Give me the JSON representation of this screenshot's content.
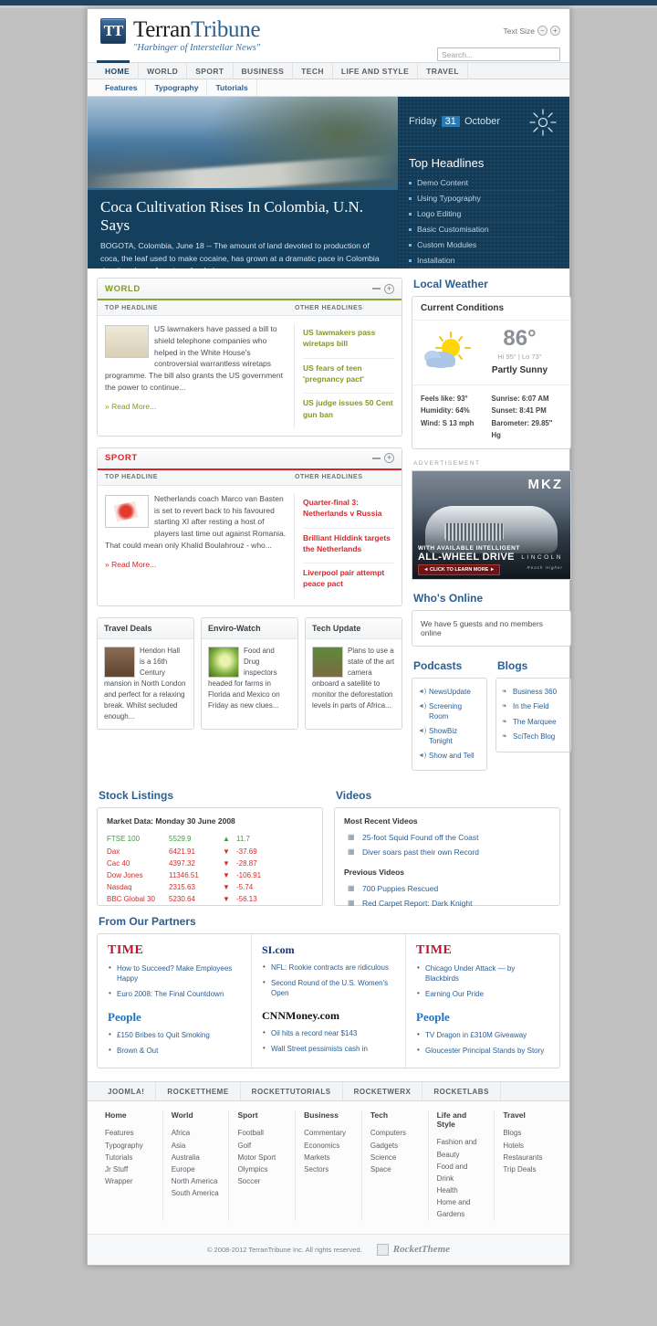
{
  "header": {
    "logo_mark": "TT",
    "title_a": "Terran",
    "title_b": "Tribune",
    "tagline": "\"Harbinger of Interstellar News\"",
    "text_size_label": "Text Size",
    "text_size_decrease": "−",
    "text_size_increase": "+",
    "search_placeholder": "Search..."
  },
  "nav": {
    "items": [
      {
        "label": "HOME",
        "active": true
      },
      {
        "label": "WORLD",
        "active": false
      },
      {
        "label": "SPORT",
        "active": false
      },
      {
        "label": "BUSINESS",
        "active": false
      },
      {
        "label": "TECH",
        "active": false
      },
      {
        "label": "LIFE AND STYLE",
        "active": false
      },
      {
        "label": "TRAVEL",
        "active": false
      }
    ],
    "sub_items": [
      {
        "label": "Features"
      },
      {
        "label": "Typography"
      },
      {
        "label": "Tutorials"
      }
    ]
  },
  "hero": {
    "headline": "Coca Cultivation Rises In Colombia, U.N. Says",
    "body": "BOGOTA, Colombia, June 18 -- The amount of land devoted to production of coca, the leaf used to make cocaine, has grown at a dramatic pace in Colombia despite a huge American-funded...",
    "date_day": "Friday",
    "date_num": "31",
    "date_month": "October",
    "headlines_title": "Top Headlines",
    "headlines": [
      {
        "label": "Demo Content"
      },
      {
        "label": "Using Typography"
      },
      {
        "label": "Logo Editing"
      },
      {
        "label": "Basic Customisation"
      },
      {
        "label": "Custom Modules"
      },
      {
        "label": "Installation"
      }
    ]
  },
  "world": {
    "title": "WORLD",
    "accent": "#8aa826",
    "sub_top": "TOP HEADLINE",
    "sub_other": "OTHER HEADLINES",
    "article": "US lawmakers have passed a bill to shield telephone companies who helped in the White House's controversial warrantless wiretaps programme. The bill also grants the US government the power to continue...",
    "read_more": "» Read More...",
    "other": [
      {
        "label": "US lawmakers pass wiretaps bill"
      },
      {
        "label": "US fears of teen 'pregnancy pact'"
      },
      {
        "label": "US judge issues 50 Cent gun ban"
      }
    ]
  },
  "sport": {
    "title": "SPORT",
    "accent": "#d8262b",
    "sub_top": "TOP HEADLINE",
    "sub_other": "OTHER HEADLINES",
    "article": "Netherlands coach Marco van Basten is set to revert back to his favoured starting XI after resting a host of players last time out against Romania. That could mean only Khalid Boulahrouz - who...",
    "read_more": "» Read More...",
    "other": [
      {
        "label": "Quarter-final 3: Netherlands v Russia"
      },
      {
        "label": "Brilliant Hiddink targets the Netherlands"
      },
      {
        "label": "Liverpool pair attempt peace pact"
      }
    ]
  },
  "cards": [
    {
      "title": "Travel Deals",
      "body": "Hendon Hall is a 16th Century mansion in North London and perfect for a relaxing break. Whilst secluded enough..."
    },
    {
      "title": "Enviro-Watch",
      "body": "Food and Drug inspectors headed for farms in Florida and Mexico on Friday as new clues..."
    },
    {
      "title": "Tech Update",
      "body": "Plans to use a state of the art camera onboard a satellite to monitor the deforestation levels in parts of Africa..."
    }
  ],
  "weather": {
    "section_title": "Local Weather",
    "box_title": "Current Conditions",
    "temp": "86°",
    "hilo": "Hi 95° | Lo 73°",
    "condition": "Partly Sunny",
    "feels_like": "Feels like: 93°",
    "humidity": "Humidity: 64%",
    "wind": "Wind: S 13 mph",
    "sunrise": "Sunrise: 6:07 AM",
    "sunset": "Sunset: 8:41 PM",
    "barometer": "Barometer: 29.85\" Hg"
  },
  "ad": {
    "label": "ADVERTISEMENT",
    "model": "MKZ",
    "brand_top": "LINCOLN",
    "line1": "WITH AVAILABLE INTELLIGENT",
    "line2": "ALL-WHEEL DRIVE",
    "cta": "◄ CLICK TO LEARN MORE ►",
    "brand": "LINCOLN",
    "brand_sub": "Reach Higher"
  },
  "whos_online": {
    "title": "Who's Online",
    "text": "We have 5 guests and no members online"
  },
  "podcasts": {
    "title": "Podcasts",
    "items": [
      {
        "label": "NewsUpdate"
      },
      {
        "label": "Screening Room"
      },
      {
        "label": "ShowBiz Tonight"
      },
      {
        "label": "Show and Tell"
      }
    ]
  },
  "blogs": {
    "title": "Blogs",
    "items": [
      {
        "label": "Business 360"
      },
      {
        "label": "In the Field"
      },
      {
        "label": "The Marquee"
      },
      {
        "label": "SciTech Blog"
      }
    ]
  },
  "stocks": {
    "title": "Stock Listings",
    "market_data": "Market Data: Monday 30 June 2008",
    "rows": [
      {
        "name": "FTSE 100",
        "value": "5529.9",
        "dir": "up",
        "change": "11.7"
      },
      {
        "name": "Dax",
        "value": "6421.91",
        "dir": "down",
        "change": "-37.69"
      },
      {
        "name": "Cac 40",
        "value": "4397.32",
        "dir": "down",
        "change": "-28.87"
      },
      {
        "name": "Dow Jones",
        "value": "11346.51",
        "dir": "down",
        "change": "-106.91"
      },
      {
        "name": "Nasdaq",
        "value": "2315.63",
        "dir": "down",
        "change": "-5.74"
      },
      {
        "name": "BBC Global 30",
        "value": "5230.64",
        "dir": "down",
        "change": "-56.13"
      }
    ]
  },
  "videos": {
    "title": "Videos",
    "group1": "Most Recent Videos",
    "group1_items": [
      {
        "label": "25-foot Squid Found off the Coast"
      },
      {
        "label": "Diver soars past their own Record"
      }
    ],
    "group2": "Previous Videos",
    "group2_items": [
      {
        "label": "700 Puppies Rescued"
      },
      {
        "label": "Red Carpet Report: Dark Knight"
      }
    ]
  },
  "partners": {
    "title": "From Our Partners",
    "columns": [
      {
        "blocks": [
          {
            "brand": "TIME",
            "brand_kind": "time",
            "items": [
              {
                "label": "How to Succeed? Make Employees Happy"
              },
              {
                "label": "Euro 2008: The Final Countdown"
              }
            ]
          },
          {
            "brand": "People",
            "brand_kind": "people",
            "items": [
              {
                "label": "£150 Bribes to Quit Smoking"
              },
              {
                "label": "Brown & Out"
              }
            ]
          }
        ]
      },
      {
        "blocks": [
          {
            "brand": "SI.com",
            "brand_kind": "si",
            "items": [
              {
                "label": "NFL: Rookie contracts are ridiculous"
              },
              {
                "label": "Second Round of the U.S. Women's Open"
              }
            ]
          },
          {
            "brand": "CNNMoney.com",
            "brand_kind": "cnn",
            "items": [
              {
                "label": "Oil hits a record near $143"
              },
              {
                "label": "Wall Street pessimists cash in"
              }
            ]
          }
        ]
      },
      {
        "blocks": [
          {
            "brand": "TIME",
            "brand_kind": "time",
            "items": [
              {
                "label": "Chicago Under Attack — by Blackbirds"
              },
              {
                "label": "Earning Our Pride"
              }
            ]
          },
          {
            "brand": "People",
            "brand_kind": "people",
            "items": [
              {
                "label": "TV Dragon in £310M Giveaway"
              },
              {
                "label": "Gloucester Principal Stands by Story"
              }
            ]
          }
        ]
      }
    ]
  },
  "footer": {
    "nav": [
      {
        "label": "JOOMLA!"
      },
      {
        "label": "ROCKETTHEME"
      },
      {
        "label": "ROCKETTUTORIALS"
      },
      {
        "label": "ROCKETWERX"
      },
      {
        "label": "ROCKETLABS"
      }
    ],
    "columns": [
      {
        "title": "Home",
        "links": [
          "Features",
          "Typography",
          "Tutorials",
          "Jr Stuff",
          "Wrapper"
        ]
      },
      {
        "title": "World",
        "links": [
          "Africa",
          "Asia",
          "Australia",
          "Europe",
          "North America",
          "South America"
        ]
      },
      {
        "title": "Sport",
        "links": [
          "Football",
          "Golf",
          "Motor Sport",
          "Olympics",
          "Soccer"
        ]
      },
      {
        "title": "Business",
        "links": [
          "Commentary",
          "Economics",
          "Markets",
          "Sectors"
        ]
      },
      {
        "title": "Tech",
        "links": [
          "Computers",
          "Gadgets",
          "Science",
          "Space"
        ]
      },
      {
        "title": "Life and Style",
        "links": [
          "Fashion and Beauty",
          "Food and Drink",
          "Health",
          "Home and Gardens"
        ]
      },
      {
        "title": "Travel",
        "links": [
          "Blogs",
          "Hotels",
          "Restaurants",
          "Trip Deals"
        ]
      }
    ],
    "copyright": "© 2008-2012 TerranTribune Inc. All rights reserved.",
    "rocket": "RocketTheme"
  }
}
